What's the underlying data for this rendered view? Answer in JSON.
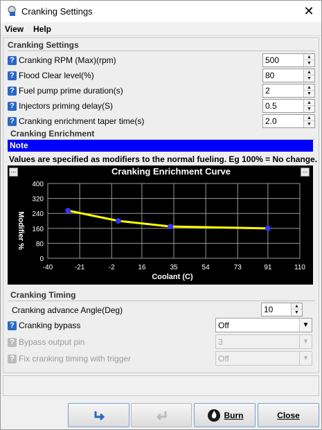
{
  "window": {
    "title": "Cranking Settings",
    "close_glyph": "✕"
  },
  "menu": [
    {
      "label": "View"
    },
    {
      "label": "Help"
    }
  ],
  "cranking_settings": {
    "title": "Cranking Settings",
    "rows": [
      {
        "label": "Cranking RPM (Max)(rpm)",
        "value": "500"
      },
      {
        "label": "Flood Clear level(%)",
        "value": "80"
      },
      {
        "label": "Fuel pump prime duration(s)",
        "value": "2"
      },
      {
        "label": "Injectors priming delay(S)",
        "value": "0.5"
      },
      {
        "label": "Cranking enrichment taper time(s)",
        "value": "2.0"
      }
    ]
  },
  "cranking_enrichment": {
    "title": "Cranking Enrichment",
    "note_title": "Note",
    "note_text": "Values are specified as modifiers to the normal fueling. Eg 100% = No change."
  },
  "chart_data": {
    "type": "line",
    "title": "Cranking Enrichment Curve",
    "xlabel": "Coolant (C)",
    "ylabel": "Modifier %",
    "x_ticks": [
      "-40",
      "-21",
      "-2",
      "16",
      "35",
      "54",
      "73",
      "91",
      "110"
    ],
    "y_ticks": [
      "0",
      "80",
      "160",
      "240",
      "320",
      "400"
    ],
    "xlim": [
      -40,
      110
    ],
    "ylim": [
      0,
      400
    ],
    "grid": true,
    "background": "#000000",
    "line_color": "#ffff00",
    "point_color": "#3333ff",
    "series": [
      {
        "x": [
          -28,
          2,
          33,
          91
        ],
        "values": [
          255,
          200,
          170,
          160
        ]
      }
    ]
  },
  "cranking_timing": {
    "title": "Cranking Timing",
    "advance": {
      "label": "Cranking advance Angle(Deg)",
      "value": "10"
    },
    "bypass": {
      "label": "Cranking bypass",
      "value": "Off"
    },
    "bypass_pin": {
      "label": "Bypass output pin",
      "value": "3"
    },
    "fix_timing": {
      "label": "Fix cranking timing with trigger",
      "value": "Off"
    }
  },
  "buttons": {
    "undo": {
      "icon": "undo-icon"
    },
    "redo": {
      "icon": "redo-icon"
    },
    "burn": {
      "label": "Burn",
      "icon": "flame-icon"
    },
    "close": {
      "label": "Close"
    }
  },
  "colors": {
    "note_bar": "#0000ff",
    "help_icon": "#2a67c5",
    "button_border": "#7a9cd3"
  }
}
